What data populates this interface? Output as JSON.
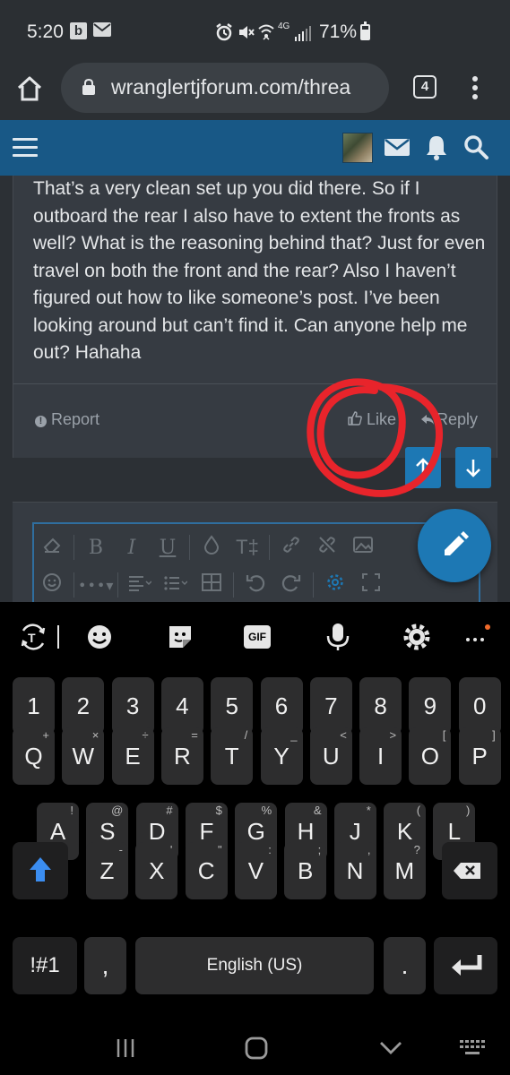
{
  "status_bar": {
    "time": "5:20",
    "notif_b": "b",
    "network": "4G",
    "battery": "71%"
  },
  "browser": {
    "url": "wranglertjforum.com/threa",
    "tab_count": "4"
  },
  "post": {
    "text": "That’s a very clean set up you did there. So if I outboard the rear I also have to extent the fronts as well? What is the reasoning behind that? Just for even travel on both the front and the rear? Also I haven’t figured out how to like someone’s post. I’ve been looking around but can’t find it. Can anyone help me out? Hahaha",
    "report_label": "Report",
    "like_label": "Like",
    "reply_label": "Reply"
  },
  "annotation": {
    "color": "#e8242b"
  },
  "editor_toolbar": {
    "row1": [
      "eraser-icon",
      "bold",
      "italic",
      "underline",
      "drop-icon",
      "text-size",
      "link-icon",
      "unlink-icon",
      "image-icon"
    ],
    "row2": [
      "smiley-icon",
      "more-icon",
      "align-icon",
      "list-icon",
      "table-icon",
      "undo-icon",
      "redo-icon",
      "settings-icon",
      "fullscreen-icon"
    ],
    "bold_label": "B",
    "italic_label": "I",
    "underline_label": "U",
    "textsize_label": "T‡"
  },
  "keyboard": {
    "toolbar": [
      "translate-icon",
      "emoji-icon",
      "sticker-icon",
      "gif-icon",
      "mic-icon",
      "settings-icon",
      "more-icon"
    ],
    "gif_label": "GIF",
    "row_numbers": [
      "1",
      "2",
      "3",
      "4",
      "5",
      "6",
      "7",
      "8",
      "9",
      "0"
    ],
    "row1": [
      {
        "k": "Q",
        "s": "+"
      },
      {
        "k": "W",
        "s": "×"
      },
      {
        "k": "E",
        "s": "÷"
      },
      {
        "k": "R",
        "s": "="
      },
      {
        "k": "T",
        "s": "/"
      },
      {
        "k": "Y",
        "s": "_"
      },
      {
        "k": "U",
        "s": "<"
      },
      {
        "k": "I",
        "s": ">"
      },
      {
        "k": "O",
        "s": "["
      },
      {
        "k": "P",
        "s": "]"
      }
    ],
    "row2": [
      {
        "k": "A",
        "s": "!"
      },
      {
        "k": "S",
        "s": "@"
      },
      {
        "k": "D",
        "s": "#"
      },
      {
        "k": "F",
        "s": "$"
      },
      {
        "k": "G",
        "s": "%"
      },
      {
        "k": "H",
        "s": "&"
      },
      {
        "k": "J",
        "s": "*"
      },
      {
        "k": "K",
        "s": "("
      },
      {
        "k": "L",
        "s": ")"
      }
    ],
    "row3": [
      {
        "k": "Z",
        "s": "-"
      },
      {
        "k": "X",
        "s": "'"
      },
      {
        "k": "C",
        "s": "\""
      },
      {
        "k": "V",
        "s": ":"
      },
      {
        "k": "B",
        "s": ";"
      },
      {
        "k": "N",
        "s": ","
      },
      {
        "k": "M",
        "s": "?"
      }
    ],
    "symbols_label": "!#1",
    "comma_label": ",",
    "space_label": "English (US)",
    "period_label": ".",
    "shift_color": "#3b8df0"
  },
  "colors": {
    "header_blue": "#185886",
    "accent_blue": "#1d78b4",
    "content_bg": "#2c3035",
    "card_bg": "#363b42"
  }
}
